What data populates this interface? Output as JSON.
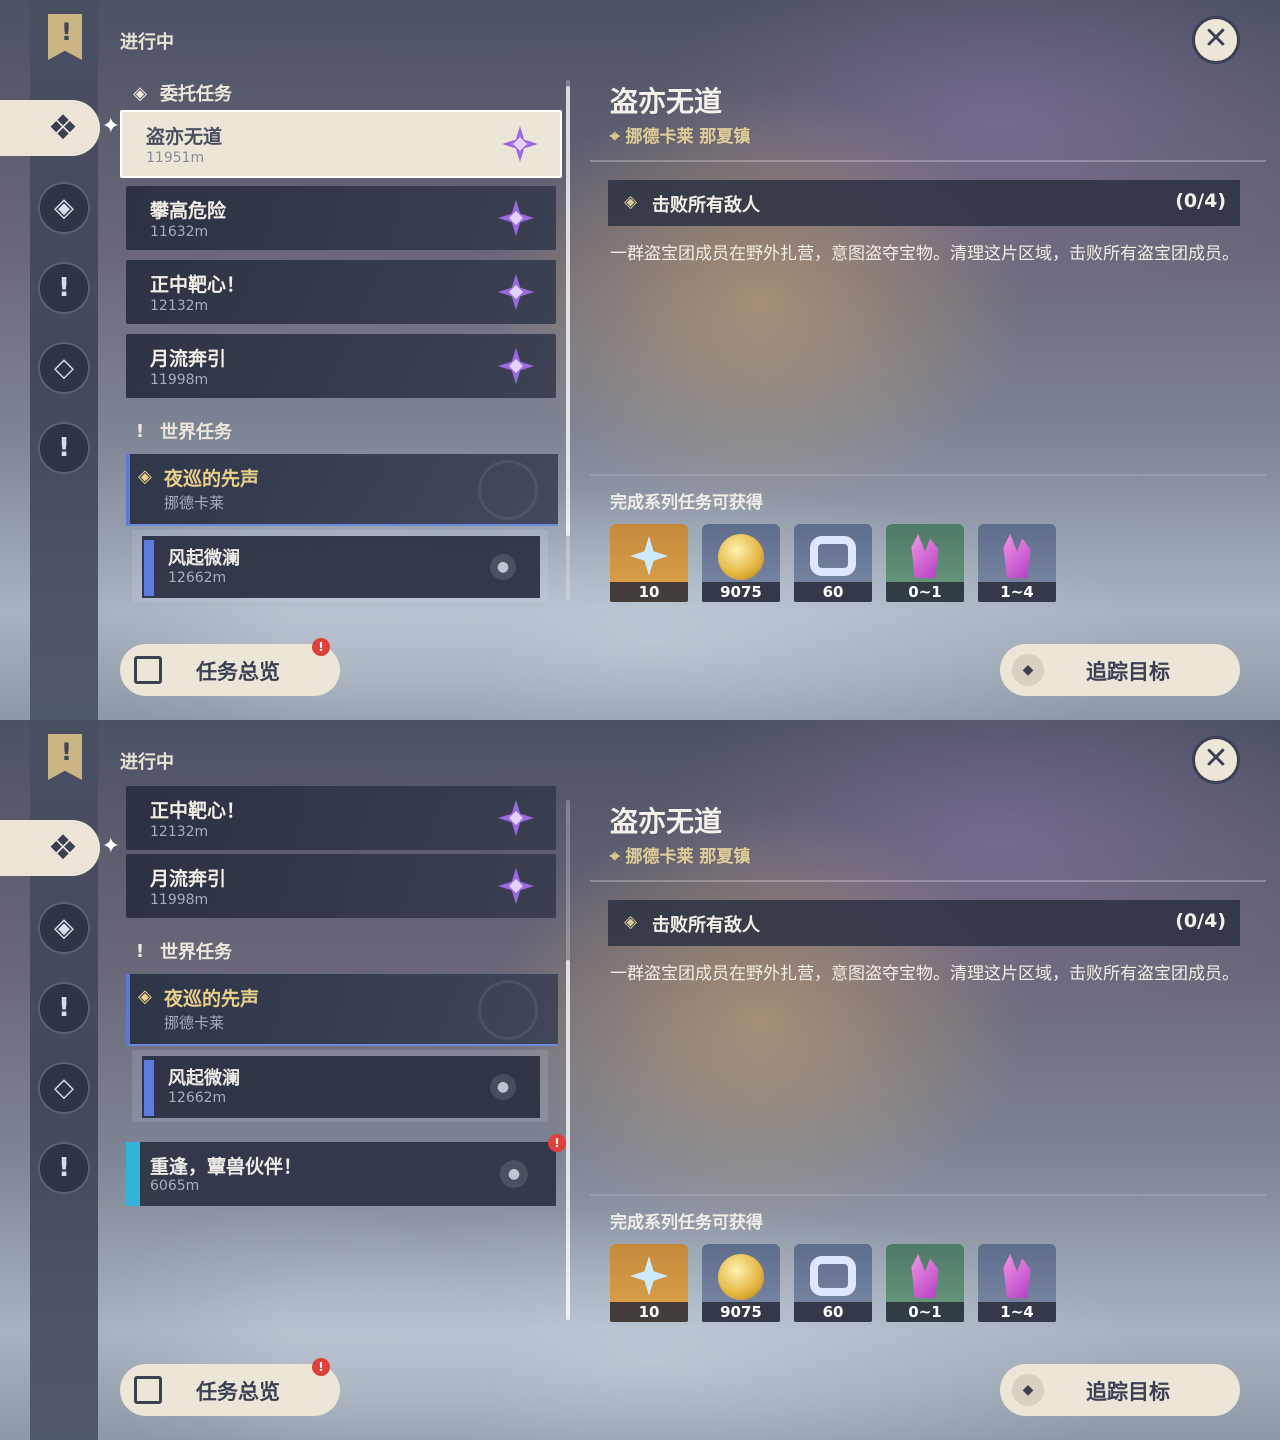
{
  "header": "进行中",
  "sections": {
    "commission": "委托任务",
    "world": "世界任务"
  },
  "commissions": [
    {
      "title": "盗亦无道",
      "distance": "11951m"
    },
    {
      "title": "攀高危险",
      "distance": "11632m"
    },
    {
      "title": "正中靶心！",
      "distance": "12132m"
    },
    {
      "title": "月流奔引",
      "distance": "11998m"
    }
  ],
  "world_quest": {
    "title": "夜巡的先声",
    "region": "挪德卡莱"
  },
  "sub_quest": {
    "title": "风起微澜",
    "distance": "12662m"
  },
  "side_quest": {
    "title": "重逢，蕈兽伙伴！",
    "distance": "6065m"
  },
  "detail": {
    "title": "盗亦无道",
    "location": "挪德卡莱 那夏镇",
    "objective": "击败所有敌人",
    "progress": "(0/4)",
    "description": "一群盗宝团成员在野外扎营，意图盗夺宝物。清理这片区域，击败所有盗宝团成员。",
    "rewards_label": "完成系列任务可获得",
    "rewards": [
      {
        "icon": "primogem-icon",
        "value": "10"
      },
      {
        "icon": "mora-coin-icon",
        "value": "9075"
      },
      {
        "icon": "adventure-exp-icon",
        "value": "60"
      },
      {
        "icon": "crystal-icon",
        "value": "0~1"
      },
      {
        "icon": "crystal-cluster-icon",
        "value": "1~4"
      }
    ]
  },
  "buttons": {
    "overview": "任务总览",
    "track": "追踪目标"
  },
  "colors": {
    "panel_light": "#ece6d8",
    "accent_gold": "#e8cf8a",
    "commission_star": "#9a6ae0",
    "side_quest_bar": "#32b3d8",
    "alert_red": "#e0403a"
  }
}
